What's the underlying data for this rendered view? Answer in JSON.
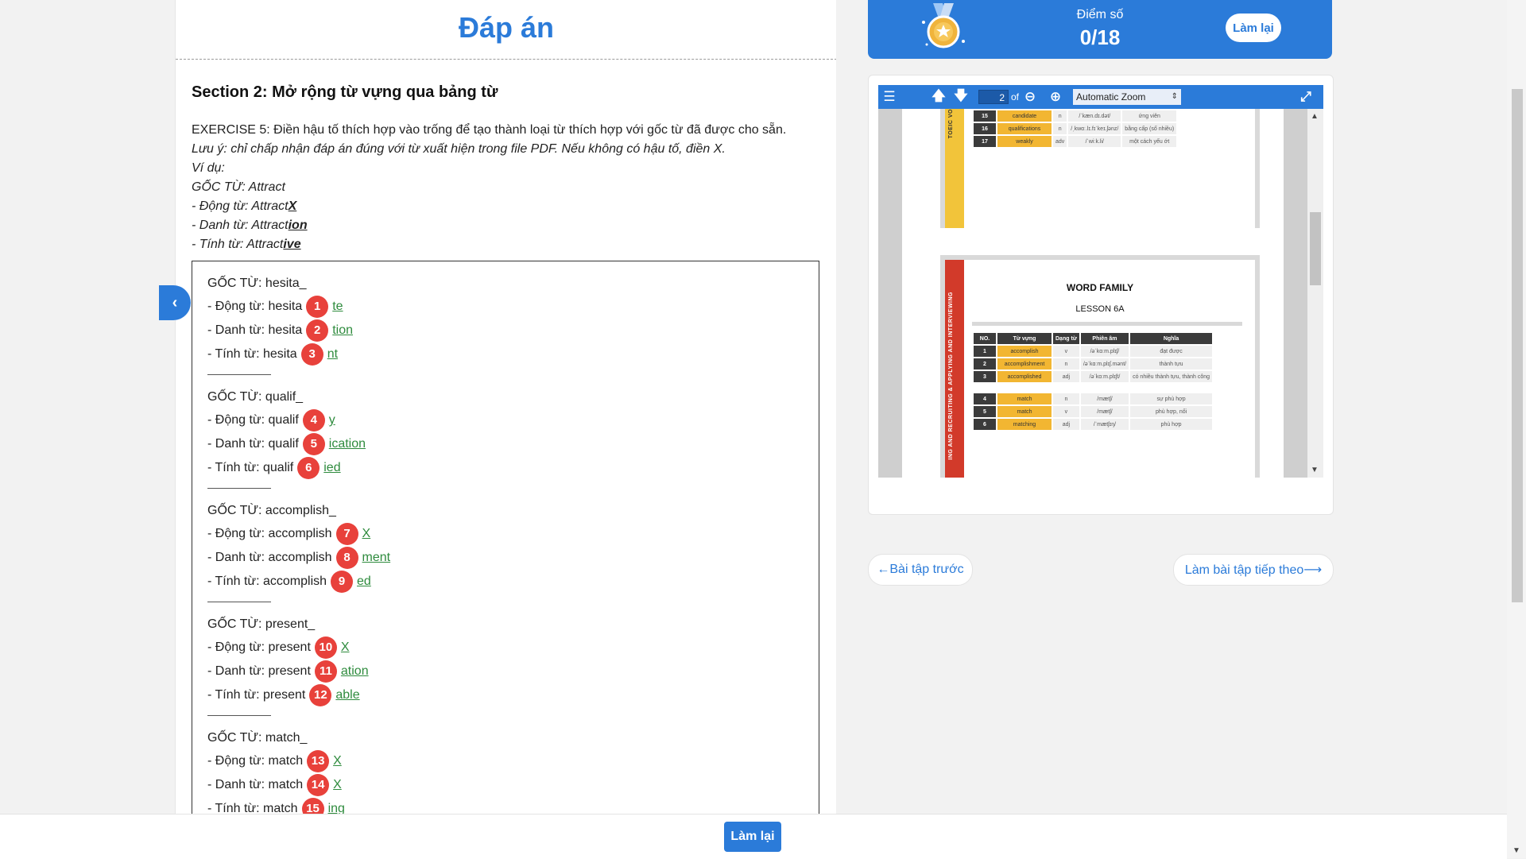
{
  "answer_title": "Đáp án",
  "section_title": "Section 2: Mở rộng từ vựng qua bảng từ",
  "exercise": {
    "instruction": "EXERCISE 5: Điền hậu tố thích hợp vào trống để tạo thành loại từ thích hợp với gốc từ đã được cho sẵn.",
    "note": "Lưu ý: chỉ chấp nhận đáp án đúng với từ xuất hiện trong file PDF. Nếu không có hậu tố, điền X.",
    "example_label": "Ví dụ:",
    "example_root": "GỐC TỪ: Attract",
    "example_verb_prefix": "- Động từ: Attract",
    "example_verb_suffix": "X",
    "example_noun_prefix": "- Danh từ: Attract",
    "example_noun_suffix": "ion",
    "example_adj_prefix": "- Tính từ: Attract",
    "example_adj_suffix": "ive"
  },
  "groups": [
    {
      "root": "GỐC TỪ: hesita_",
      "rows": [
        {
          "label": "- Động từ: hesita",
          "num": "1",
          "answer": "te"
        },
        {
          "label": "- Danh từ: hesita",
          "num": "2",
          "answer": "tion"
        },
        {
          "label": "- Tính từ: hesita",
          "num": "3",
          "answer": "nt"
        }
      ]
    },
    {
      "root": "GỐC TỪ: qualif_",
      "rows": [
        {
          "label": "- Động từ: qualif",
          "num": "4",
          "answer": "y"
        },
        {
          "label": "- Danh từ: qualif",
          "num": "5",
          "answer": "ication"
        },
        {
          "label": "- Tính từ: qualif",
          "num": "6",
          "answer": "ied"
        }
      ]
    },
    {
      "root": "GỐC TỪ: accomplish_",
      "rows": [
        {
          "label": "- Động từ: accomplish",
          "num": "7",
          "answer": "X"
        },
        {
          "label": "- Danh từ: accomplish",
          "num": "8",
          "answer": "ment"
        },
        {
          "label": "- Tính từ: accomplish",
          "num": "9",
          "answer": "ed"
        }
      ]
    },
    {
      "root": "GỐC TỪ: present_",
      "rows": [
        {
          "label": "- Động từ: present",
          "num": "10",
          "answer": "X"
        },
        {
          "label": "- Danh từ: present",
          "num": "11",
          "answer": "ation"
        },
        {
          "label": "- Tính từ: present",
          "num": "12",
          "answer": "able"
        }
      ]
    },
    {
      "root": "GỐC TỪ: match_",
      "rows": [
        {
          "label": "- Động từ: match",
          "num": "13",
          "answer": "X"
        },
        {
          "label": "- Danh từ: match",
          "num": "14",
          "answer": "X"
        },
        {
          "label": "- Tính từ: match",
          "num": "15",
          "answer": "ing"
        }
      ]
    }
  ],
  "score": {
    "label": "Điểm số",
    "value": "0/18",
    "retry": "Làm lại"
  },
  "pdf": {
    "page": "2",
    "of": "of",
    "zoom": "Automatic Zoom",
    "side_text_1": "TOEIC VO",
    "side_text_2": "ING AND RECRUITING & APPLYING AND INTERVIEWING",
    "page1_rows": [
      {
        "no": "15",
        "word": "candidate",
        "type": "n",
        "ipa": "/ˈkæn.dɪ.dət/",
        "meaning": "ứng viên"
      },
      {
        "no": "16",
        "word": "qualifications",
        "type": "n",
        "ipa": "/ˌkwɑː.lɪ.fɪˈkeɪ.ʃənz/",
        "meaning": "bằng cấp (số nhiều)"
      },
      {
        "no": "17",
        "word": "weakly",
        "type": "adv",
        "ipa": "/ˈwiːk.li/",
        "meaning": "một cách yếu ớt"
      }
    ],
    "title": "WORD FAMILY",
    "lesson": "LESSON 6A",
    "headers": [
      "NO.",
      "Từ vựng",
      "Dạng từ",
      "Phiên âm",
      "Nghĩa"
    ],
    "page2_rows": [
      {
        "no": "1",
        "word": "accomplish",
        "type": "v",
        "ipa": "/əˈkɑːm.plɪʃ/",
        "meaning": "đạt được"
      },
      {
        "no": "2",
        "word": "accomplishment",
        "type": "n",
        "ipa": "/əˈkɑːm.plɪʃ.mənt/",
        "meaning": "thành tựu"
      },
      {
        "no": "3",
        "word": "accomplished",
        "type": "adj",
        "ipa": "/əˈkɑːm.plɪʃt/",
        "meaning": "có nhiều thành tựu, thành công"
      },
      {
        "no": "4",
        "word": "match",
        "type": "n",
        "ipa": "/mætʃ/",
        "meaning": "sự phù hợp"
      },
      {
        "no": "5",
        "word": "match",
        "type": "v",
        "ipa": "/mætʃ/",
        "meaning": "phù hợp, nối"
      },
      {
        "no": "6",
        "word": "matching",
        "type": "adj",
        "ipa": "/ˈmætʃɪŋ/",
        "meaning": "phù hợp"
      }
    ]
  },
  "nav": {
    "prev": "←Bài tập trước",
    "next": "Làm bài tập tiếp theo⟶"
  },
  "bottom_retry": "Làm lại",
  "colors": {
    "accent": "#2b7bd9",
    "badge": "#e8413b",
    "answer": "#2e8b3d",
    "pdf_word": "#f2b632",
    "pdf_band_red": "#d23a2a",
    "pdf_band_yellow": "#f2c43a"
  },
  "icons": [
    "medal-icon",
    "chevron-left-icon",
    "menu-icon",
    "arrow-up-icon",
    "arrow-down-icon",
    "zoom-out-icon",
    "zoom-in-icon",
    "fullscreen-icon"
  ]
}
